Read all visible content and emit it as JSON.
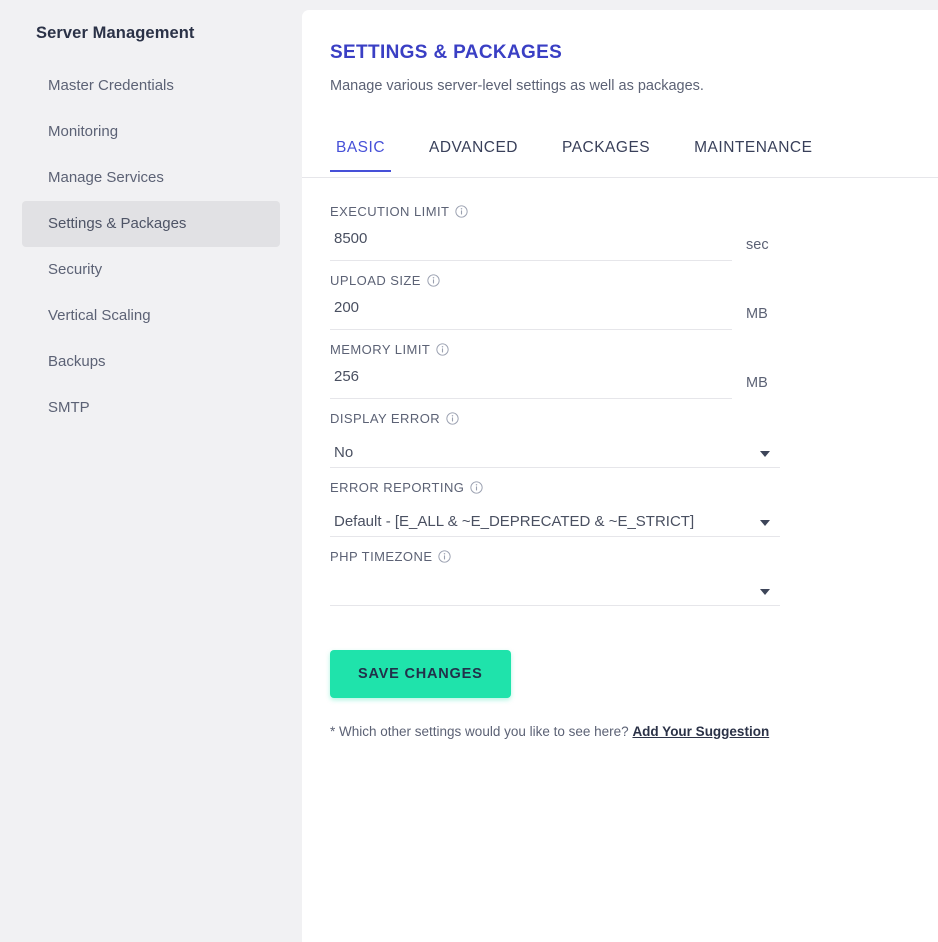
{
  "sidebar": {
    "title": "Server Management",
    "items": [
      {
        "label": "Master Credentials",
        "active": false
      },
      {
        "label": "Monitoring",
        "active": false
      },
      {
        "label": "Manage Services",
        "active": false
      },
      {
        "label": "Settings & Packages",
        "active": true
      },
      {
        "label": "Security",
        "active": false
      },
      {
        "label": "Vertical Scaling",
        "active": false
      },
      {
        "label": "Backups",
        "active": false
      },
      {
        "label": "SMTP",
        "active": false
      }
    ]
  },
  "header": {
    "title": "SETTINGS & PACKAGES",
    "subtitle": "Manage various server-level settings as well as packages."
  },
  "tabs": [
    {
      "label": "BASIC",
      "active": true
    },
    {
      "label": "ADVANCED",
      "active": false
    },
    {
      "label": "PACKAGES",
      "active": false
    },
    {
      "label": "MAINTENANCE",
      "active": false
    }
  ],
  "fields": {
    "execution_limit": {
      "label": "EXECUTION LIMIT",
      "value": "8500",
      "unit": "sec"
    },
    "upload_size": {
      "label": "UPLOAD SIZE",
      "value": "200",
      "unit": "MB"
    },
    "memory_limit": {
      "label": "MEMORY LIMIT",
      "value": "256",
      "unit": "MB"
    },
    "display_error": {
      "label": "DISPLAY ERROR",
      "value": "No"
    },
    "error_reporting": {
      "label": "ERROR REPORTING",
      "value": "Default - [E_ALL & ~E_DEPRECATED & ~E_STRICT]"
    },
    "php_timezone": {
      "label": "PHP TIMEZONE",
      "value": ""
    }
  },
  "actions": {
    "save_label": "SAVE CHANGES"
  },
  "footnote": {
    "text": "* Which other settings would you like to see here?",
    "link_label": "Add Your Suggestion"
  },
  "icons": {
    "info": "info-circle-icon",
    "caret": "chevron-down-icon"
  },
  "colors": {
    "accent_green": "#1fe3ab",
    "title_indigo": "#3a3fc4",
    "tab_active": "#4650d8",
    "sidebar_bg": "#f1f1f3",
    "panel_bg": "#ffffff"
  }
}
